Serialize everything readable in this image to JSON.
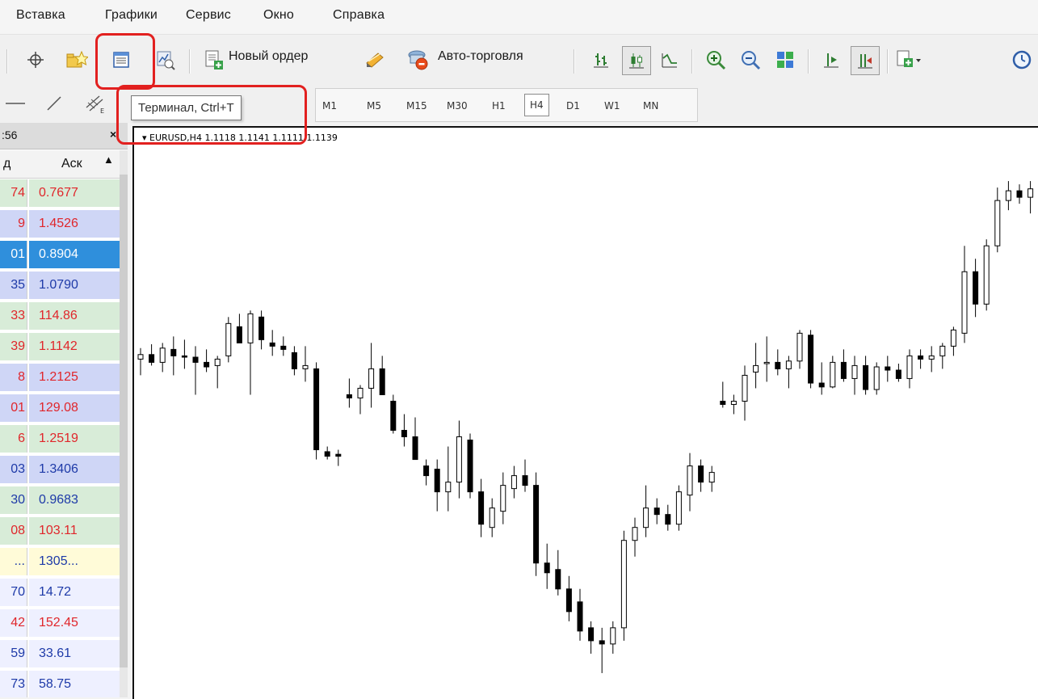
{
  "menu": [
    "Вставка",
    "Графики",
    "Сервис",
    "Окно",
    "Справка"
  ],
  "toolbar": {
    "new_order_label": "Новый ордер",
    "autotrading_label": "Авто-торговля",
    "icons": [
      "crosshair-icon",
      "favorites-icon",
      "terminal-icon",
      "strategy-tester-icon",
      "new-order-icon",
      "metaeditor-icon",
      "autotrading-icon",
      "bar-chart-icon",
      "candlestick-icon",
      "line-chart-icon",
      "zoom-in-icon",
      "zoom-out-icon",
      "tile-windows-icon",
      "auto-scroll-icon",
      "chart-shift-icon",
      "indicators-icon",
      "periodicity-icon"
    ]
  },
  "tooltip": "Терминал, Ctrl+T",
  "periods": [
    "M1",
    "M5",
    "M15",
    "M30",
    "H1",
    "H4",
    "D1",
    "W1",
    "MN"
  ],
  "active_period": "H4",
  "market_watch": {
    "time": ":56",
    "close_glyph": "×",
    "columns": {
      "bid": "д",
      "ask": "Аск"
    },
    "rows": [
      {
        "bid": "74",
        "ask": "0.7677",
        "color": "red",
        "bg": "#d8ecd8"
      },
      {
        "bid": "9",
        "ask": "1.4526",
        "color": "red",
        "bg": "#cfd6f6"
      },
      {
        "bid": "01",
        "ask": "0.8904",
        "color": "white",
        "bg": "#2f8fdc"
      },
      {
        "bid": "35",
        "ask": "1.0790",
        "color": "blue",
        "bg": "#cfd6f6"
      },
      {
        "bid": "33",
        "ask": "114.86",
        "color": "red",
        "bg": "#d8ecd8"
      },
      {
        "bid": "39",
        "ask": "1.1142",
        "color": "red",
        "bg": "#d8ecd8"
      },
      {
        "bid": "8",
        "ask": "1.2125",
        "color": "red",
        "bg": "#cfd6f6"
      },
      {
        "bid": "01",
        "ask": "129.08",
        "color": "red",
        "bg": "#cfd6f6"
      },
      {
        "bid": "6",
        "ask": "1.2519",
        "color": "red",
        "bg": "#d8ecd8"
      },
      {
        "bid": "03",
        "ask": "1.3406",
        "color": "blue",
        "bg": "#cfd6f6"
      },
      {
        "bid": "30",
        "ask": "0.9683",
        "color": "blue",
        "bg": "#d8ecd8"
      },
      {
        "bid": "08",
        "ask": "103.11",
        "color": "red",
        "bg": "#d8ecd8"
      },
      {
        "bid": "...",
        "ask": "1305...",
        "color": "blue",
        "bg": "#fffbd8"
      },
      {
        "bid": "70",
        "ask": "14.72",
        "color": "blue",
        "bg": "#eef0ff"
      },
      {
        "bid": "42",
        "ask": "152.45",
        "color": "red",
        "bg": "#eef0ff"
      },
      {
        "bid": "59",
        "ask": "33.61",
        "color": "blue",
        "bg": "#eef0ff"
      },
      {
        "bid": "73",
        "ask": "58.75",
        "color": "blue",
        "bg": "#eef0ff"
      }
    ]
  },
  "chart": {
    "header": "EURUSD,H4  1.1118 1.1141 1.1111 1.1139",
    "symbol": "EURUSD",
    "timeframe": "H4",
    "ohlc": [
      1.1118,
      1.1141,
      1.1111,
      1.1139
    ]
  },
  "chart_data": {
    "type": "candlestick",
    "title": "EURUSD,H4",
    "candles": [
      {
        "o": 1.0855,
        "h": 1.0872,
        "l": 1.083,
        "c": 1.0862
      },
      {
        "o": 1.0862,
        "h": 1.0878,
        "l": 1.0845,
        "c": 1.085
      },
      {
        "o": 1.085,
        "h": 1.088,
        "l": 1.0835,
        "c": 1.0872
      },
      {
        "o": 1.087,
        "h": 1.089,
        "l": 1.083,
        "c": 1.086
      },
      {
        "o": 1.086,
        "h": 1.0885,
        "l": 1.084,
        "c": 1.0858
      },
      {
        "o": 1.0858,
        "h": 1.0875,
        "l": 1.08,
        "c": 1.085
      },
      {
        "o": 1.085,
        "h": 1.087,
        "l": 1.0835,
        "c": 1.0843
      },
      {
        "o": 1.0845,
        "h": 1.086,
        "l": 1.081,
        "c": 1.0855
      },
      {
        "o": 1.086,
        "h": 1.092,
        "l": 1.085,
        "c": 1.091
      },
      {
        "o": 1.0905,
        "h": 1.0925,
        "l": 1.088,
        "c": 1.088
      },
      {
        "o": 1.088,
        "h": 1.093,
        "l": 1.08,
        "c": 1.0925
      },
      {
        "o": 1.092,
        "h": 1.093,
        "l": 1.087,
        "c": 1.0885
      },
      {
        "o": 1.088,
        "h": 1.09,
        "l": 1.086,
        "c": 1.0875
      },
      {
        "o": 1.0875,
        "h": 1.089,
        "l": 1.086,
        "c": 1.087
      },
      {
        "o": 1.0865,
        "h": 1.0875,
        "l": 1.083,
        "c": 1.084
      },
      {
        "o": 1.084,
        "h": 1.0875,
        "l": 1.082,
        "c": 1.0845
      },
      {
        "o": 1.084,
        "h": 1.085,
        "l": 1.07,
        "c": 1.0715
      },
      {
        "o": 1.0712,
        "h": 1.072,
        "l": 1.07,
        "c": 1.0705
      },
      {
        "o": 1.0708,
        "h": 1.0715,
        "l": 1.069,
        "c": 1.0705
      },
      {
        "o": 1.08,
        "h": 1.0825,
        "l": 1.078,
        "c": 1.0795
      },
      {
        "o": 1.0795,
        "h": 1.0815,
        "l": 1.077,
        "c": 1.081
      },
      {
        "o": 1.081,
        "h": 1.088,
        "l": 1.078,
        "c": 1.084
      },
      {
        "o": 1.084,
        "h": 1.086,
        "l": 1.08,
        "c": 1.08
      },
      {
        "o": 1.079,
        "h": 1.08,
        "l": 1.074,
        "c": 1.0745
      },
      {
        "o": 1.0745,
        "h": 1.077,
        "l": 1.072,
        "c": 1.0735
      },
      {
        "o": 1.0735,
        "h": 1.0765,
        "l": 1.07,
        "c": 1.07
      },
      {
        "o": 1.069,
        "h": 1.07,
        "l": 1.066,
        "c": 1.0675
      },
      {
        "o": 1.0685,
        "h": 1.07,
        "l": 1.062,
        "c": 1.065
      },
      {
        "o": 1.065,
        "h": 1.072,
        "l": 1.062,
        "c": 1.0665
      },
      {
        "o": 1.0665,
        "h": 1.076,
        "l": 1.064,
        "c": 1.0735
      },
      {
        "o": 1.073,
        "h": 1.074,
        "l": 1.064,
        "c": 1.065
      },
      {
        "o": 1.065,
        "h": 1.067,
        "l": 1.058,
        "c": 1.06
      },
      {
        "o": 1.0595,
        "h": 1.064,
        "l": 1.058,
        "c": 1.0625
      },
      {
        "o": 1.062,
        "h": 1.068,
        "l": 1.06,
        "c": 1.066
      },
      {
        "o": 1.0655,
        "h": 1.069,
        "l": 1.064,
        "c": 1.0675
      },
      {
        "o": 1.0675,
        "h": 1.07,
        "l": 1.065,
        "c": 1.066
      },
      {
        "o": 1.066,
        "h": 1.068,
        "l": 1.052,
        "c": 1.054
      },
      {
        "o": 1.054,
        "h": 1.057,
        "l": 1.05,
        "c": 1.0525
      },
      {
        "o": 1.053,
        "h": 1.056,
        "l": 1.049,
        "c": 1.05
      },
      {
        "o": 1.05,
        "h": 1.052,
        "l": 1.045,
        "c": 1.0465
      },
      {
        "o": 1.048,
        "h": 1.05,
        "l": 1.042,
        "c": 1.0435
      },
      {
        "o": 1.044,
        "h": 1.045,
        "l": 1.04,
        "c": 1.042
      },
      {
        "o": 1.042,
        "h": 1.044,
        "l": 1.037,
        "c": 1.0415
      },
      {
        "o": 1.0415,
        "h": 1.045,
        "l": 1.04,
        "c": 1.044
      },
      {
        "o": 1.044,
        "h": 1.059,
        "l": 1.042,
        "c": 1.0575
      },
      {
        "o": 1.0575,
        "h": 1.061,
        "l": 1.055,
        "c": 1.0595
      },
      {
        "o": 1.0595,
        "h": 1.066,
        "l": 1.058,
        "c": 1.0625
      },
      {
        "o": 1.0625,
        "h": 1.064,
        "l": 1.06,
        "c": 1.0615
      },
      {
        "o": 1.0615,
        "h": 1.063,
        "l": 1.059,
        "c": 1.06
      },
      {
        "o": 1.06,
        "h": 1.066,
        "l": 1.059,
        "c": 1.065
      },
      {
        "o": 1.0645,
        "h": 1.071,
        "l": 1.062,
        "c": 1.069
      },
      {
        "o": 1.069,
        "h": 1.07,
        "l": 1.065,
        "c": 1.0665
      },
      {
        "o": 1.0665,
        "h": 1.069,
        "l": 1.065,
        "c": 1.068
      },
      {
        "o": 1.079,
        "h": 1.082,
        "l": 1.078,
        "c": 1.0785
      },
      {
        "o": 1.0785,
        "h": 1.08,
        "l": 1.077,
        "c": 1.079
      },
      {
        "o": 1.079,
        "h": 1.0845,
        "l": 1.076,
        "c": 1.083
      },
      {
        "o": 1.0835,
        "h": 1.088,
        "l": 1.081,
        "c": 1.0845
      },
      {
        "o": 1.0848,
        "h": 1.089,
        "l": 1.082,
        "c": 1.085
      },
      {
        "o": 1.085,
        "h": 1.087,
        "l": 1.083,
        "c": 1.084
      },
      {
        "o": 1.084,
        "h": 1.086,
        "l": 1.081,
        "c": 1.0852
      },
      {
        "o": 1.0852,
        "h": 1.09,
        "l": 1.084,
        "c": 1.0895
      },
      {
        "o": 1.0892,
        "h": 1.09,
        "l": 1.081,
        "c": 1.0818
      },
      {
        "o": 1.0818,
        "h": 1.085,
        "l": 1.08,
        "c": 1.0812
      },
      {
        "o": 1.0812,
        "h": 1.086,
        "l": 1.081,
        "c": 1.085
      },
      {
        "o": 1.085,
        "h": 1.087,
        "l": 1.082,
        "c": 1.0825
      },
      {
        "o": 1.0825,
        "h": 1.086,
        "l": 1.08,
        "c": 1.0845
      },
      {
        "o": 1.0845,
        "h": 1.086,
        "l": 1.08,
        "c": 1.0808
      },
      {
        "o": 1.0808,
        "h": 1.085,
        "l": 1.08,
        "c": 1.0843
      },
      {
        "o": 1.0843,
        "h": 1.086,
        "l": 1.082,
        "c": 1.0838
      },
      {
        "o": 1.0838,
        "h": 1.0848,
        "l": 1.082,
        "c": 1.0825
      },
      {
        "o": 1.0825,
        "h": 1.087,
        "l": 1.081,
        "c": 1.086
      },
      {
        "o": 1.086,
        "h": 1.087,
        "l": 1.084,
        "c": 1.0855
      },
      {
        "o": 1.0855,
        "h": 1.0875,
        "l": 1.0835,
        "c": 1.086
      },
      {
        "o": 1.086,
        "h": 1.088,
        "l": 1.084,
        "c": 1.0875
      },
      {
        "o": 1.0875,
        "h": 1.0905,
        "l": 1.086,
        "c": 1.09
      },
      {
        "o": 1.0895,
        "h": 1.103,
        "l": 1.088,
        "c": 1.099
      },
      {
        "o": 1.099,
        "h": 1.101,
        "l": 1.092,
        "c": 1.094
      },
      {
        "o": 1.094,
        "h": 1.104,
        "l": 1.093,
        "c": 1.103
      },
      {
        "o": 1.103,
        "h": 1.112,
        "l": 1.102,
        "c": 1.11
      },
      {
        "o": 1.11,
        "h": 1.113,
        "l": 1.1085,
        "c": 1.1115
      },
      {
        "o": 1.1115,
        "h": 1.1125,
        "l": 1.1095,
        "c": 1.1105
      },
      {
        "o": 1.1105,
        "h": 1.113,
        "l": 1.108,
        "c": 1.1118
      },
      {
        "o": 1.1118,
        "h": 1.1141,
        "l": 1.1111,
        "c": 1.1139
      }
    ]
  }
}
